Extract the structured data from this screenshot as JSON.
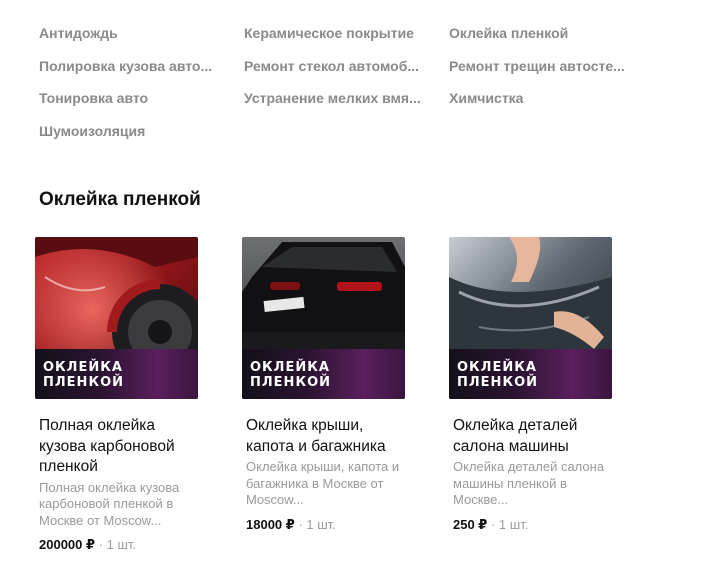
{
  "categories": [
    "Антидождь",
    "Керамическое покрытие",
    "Оклейка пленкой",
    "Полировка кузова авто...",
    "Ремонт стекол автомоб...",
    "Ремонт трещин автосте...",
    "Тонировка авто",
    "Устранение мелких вмя...",
    "Химчистка",
    "Шумоизоляция"
  ],
  "section": {
    "title": "Оклейка пленкой"
  },
  "cards": [
    {
      "image_line1": "ОКЛЕЙКА",
      "image_line2": "ПЛЕНКОЙ",
      "title": "Полная оклейка кузова карбоновой пленкой",
      "description": "Полная оклейка кузова карбоновой пленкой в Москве от Moscow...",
      "price": "200000 ₽",
      "unit": "· 1 шт."
    },
    {
      "image_line1": "ОКЛЕЙКА",
      "image_line2": "ПЛЕНКОЙ",
      "title": "Оклейка крыши, капота и багажника",
      "description": "Оклейка крыши, капота и багажника в Москве от Moscow...",
      "price": "18000 ₽",
      "unit": "· 1 шт."
    },
    {
      "image_line1": "ОКЛЕЙКА",
      "image_line2": "ПЛЕНКОЙ",
      "title": "Оклейка деталей салона машины",
      "description": "Оклейка деталей салона машины пленкой в Москве...",
      "price": "250 ₽",
      "unit": "· 1 шт."
    }
  ]
}
